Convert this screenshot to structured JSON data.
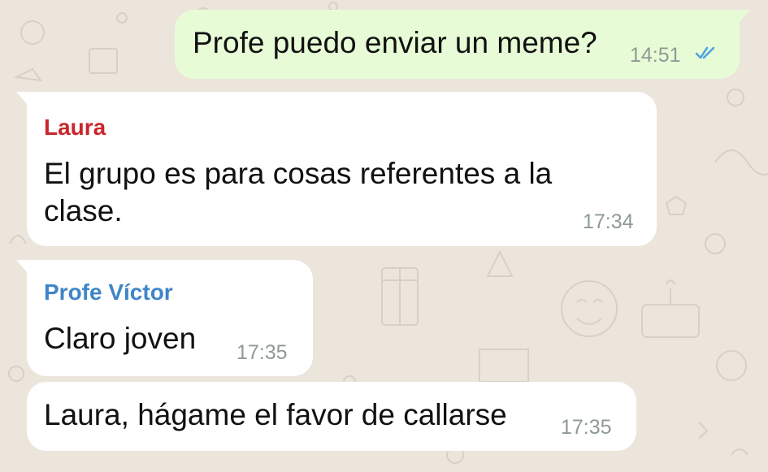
{
  "chat": {
    "messages": [
      {
        "direction": "outgoing",
        "text": "Profe puedo enviar un meme?",
        "time": "14:51",
        "status_icon": "double-check-read-icon",
        "status_color": "#4fa3e0"
      },
      {
        "direction": "incoming",
        "sender": "Laura",
        "sender_color": "#c8262b",
        "lines": [
          "El grupo es para cosas referentes a la",
          "clase."
        ],
        "time": "17:34"
      },
      {
        "direction": "incoming",
        "sender": "Profe Víctor",
        "sender_color": "#3f85c7",
        "text": "Claro joven",
        "time": "17:35"
      },
      {
        "direction": "incoming",
        "text": "Laura, hágame el favor de callarse",
        "time": "17:35"
      }
    ]
  },
  "theme": {
    "wallpaper_color": "#ece5dc",
    "outgoing_bubble_color": "#e7fcd6",
    "incoming_bubble_color": "#ffffff",
    "timestamp_color": "#8e9a95"
  }
}
